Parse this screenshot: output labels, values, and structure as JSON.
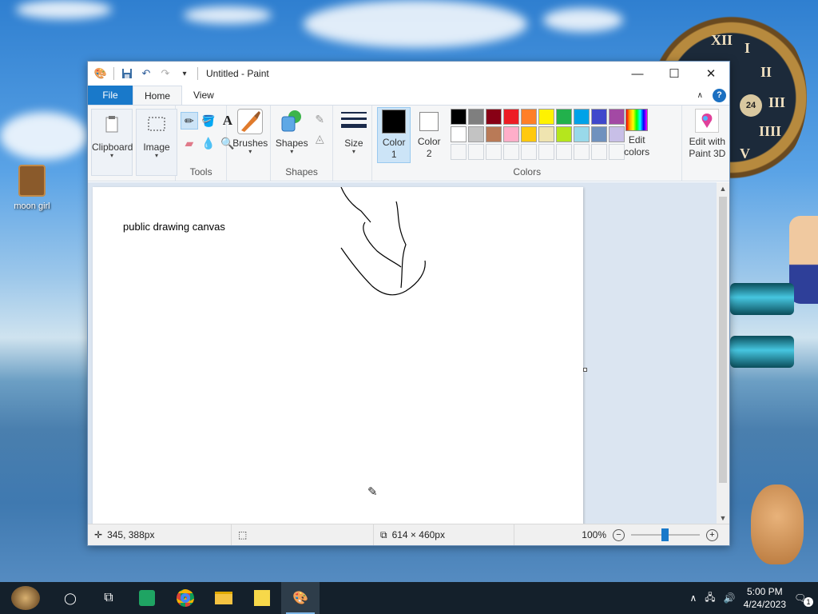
{
  "desktop": {
    "icon_label": "moon girl",
    "clock_numerals": [
      "XII",
      "I",
      "II",
      "III",
      "IIII",
      "V"
    ],
    "clock_dial": "24"
  },
  "window": {
    "title": "Untitled - Paint",
    "controls": {
      "minimize": "—",
      "maximize": "☐",
      "close": "✕"
    }
  },
  "tabs": [
    {
      "label": "File"
    },
    {
      "label": "Home"
    },
    {
      "label": "View"
    }
  ],
  "ribbon": {
    "clipboard": "Clipboard",
    "image": "Image",
    "tools_group": "Tools",
    "brushes": "Brushes",
    "shapes": "Shapes",
    "shapes_group": "Shapes",
    "size": "Size",
    "color1": "Color 1",
    "color2": "Color 2",
    "edit_colors": "Edit colors",
    "edit_paint3d": "Edit with Paint 3D",
    "colors_group": "Colors",
    "help": "?",
    "palette_row1": [
      "#000000",
      "#7f7f7f",
      "#880015",
      "#ed1c24",
      "#ff7f27",
      "#fff200",
      "#22b14c",
      "#00a2e8",
      "#3f48cc",
      "#a349a4"
    ],
    "palette_row2": [
      "#ffffff",
      "#c3c3c3",
      "#b97a57",
      "#ffaec9",
      "#ffc90e",
      "#efe4b0",
      "#b5e61d",
      "#99d9ea",
      "#7092be",
      "#c8bfe7"
    ],
    "color1_value": "#000000",
    "color2_value": "#ffffff",
    "accent": "#1979ca"
  },
  "canvas": {
    "text": "public drawing canvas"
  },
  "status": {
    "cursor_pos": "345, 388px",
    "selection": "",
    "image_size": "614 × 460px",
    "zoom": "100%"
  },
  "taskbar": {
    "time": "5:00 PM",
    "date": "4/24/2023",
    "notification_count": "1"
  }
}
